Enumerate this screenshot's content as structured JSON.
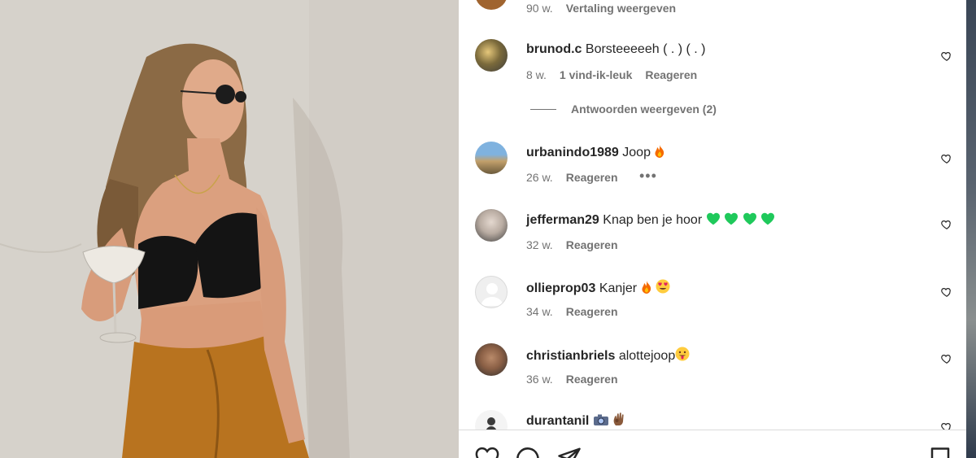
{
  "top_row": {
    "age": "90 w.",
    "translate_label": "Vertaling weergeven"
  },
  "comments": [
    {
      "username": "brunod.c",
      "text": "Borsteeeeeh ( . ) ( . )",
      "age": "8 w.",
      "likes": "1 vind-ik-leuk",
      "reply_label": "Reageren"
    },
    {
      "username": "urbanindo1989",
      "text": "Joop",
      "age": "26 w.",
      "reply_label": "Reageren",
      "more": "•••"
    },
    {
      "username": "jefferman29",
      "text": "Knap ben je hoor",
      "age": "32 w.",
      "reply_label": "Reageren"
    },
    {
      "username": "ollieprop03",
      "text": "Kanjer",
      "age": "34 w.",
      "reply_label": "Reageren"
    },
    {
      "username": "christianbriels",
      "text": "alottejoop",
      "age": "36 w.",
      "reply_label": "Reageren"
    },
    {
      "username": "durantanil",
      "text": ""
    }
  ],
  "view_replies_label": "Antwoorden weergeven (2)",
  "colors": {
    "green_heart": "#1fc95b",
    "fire": "#f56a00",
    "meta_text": "#737373",
    "text": "#262626"
  },
  "icons": [
    "heart-icon",
    "comment-icon",
    "share-icon",
    "bookmark-icon",
    "fire-emoji",
    "heart-eyes-emoji",
    "tongue-emoji",
    "camera-emoji",
    "ok-hand-emoji"
  ]
}
